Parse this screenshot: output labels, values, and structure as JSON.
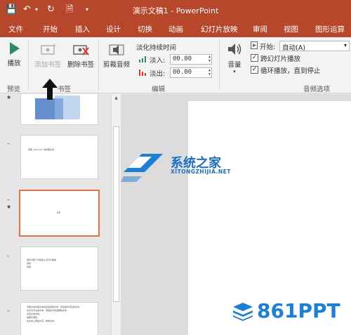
{
  "title_bar": {
    "title": "演示文稿1 - PowerPoint"
  },
  "tabs": [
    "文件",
    "开始",
    "插入",
    "设计",
    "切换",
    "动画",
    "幻灯片放映",
    "审阅",
    "视图",
    "图形运算"
  ],
  "ribbon": {
    "play_label": "播放",
    "add_bookmark_label": "添加书签",
    "remove_bookmark_label": "删除书签",
    "trim_audio_label": "剪裁音频",
    "fade_duration_label": "淡化持续时间",
    "fade_in_label": "淡入:",
    "fade_in_value": "00.00",
    "fade_out_label": "淡出:",
    "fade_out_value": "00.00",
    "volume_label": "音量",
    "start_label": "开始:",
    "start_value": "自动(A)",
    "play_across_slides_label": "跨幻灯片播放",
    "loop_label": "循环播放，直到停止",
    "groups": {
      "preview": "预览",
      "bookmarks": "书签",
      "edit": "编辑",
      "audio_options": "音频选项"
    }
  },
  "thumbnails": [
    {
      "text": ""
    },
    {
      "text": "添加《secure》的内容文本"
    },
    {
      "text": "ab"
    },
    {
      "text": "鼠标对着下方的加入幻灯片播放\n添加\n音频"
    },
    {
      "text": "可能文本内容文本在此处添加文本，然后选中对应的文本\n对齐文字文本文本，添加的为你选择的文本\n对应文本文本，\n效果可调整，\n在文本上添加文字，换成文本"
    }
  ],
  "watermark": {
    "brand_cn": "系统之家",
    "brand_url": "XITONGZHIJIA.NET",
    "brand2": "861PPT"
  },
  "colors": {
    "accent": "#b7472a",
    "selected_border": "#e0714a",
    "watermark_blue": "#1c7fd6"
  }
}
